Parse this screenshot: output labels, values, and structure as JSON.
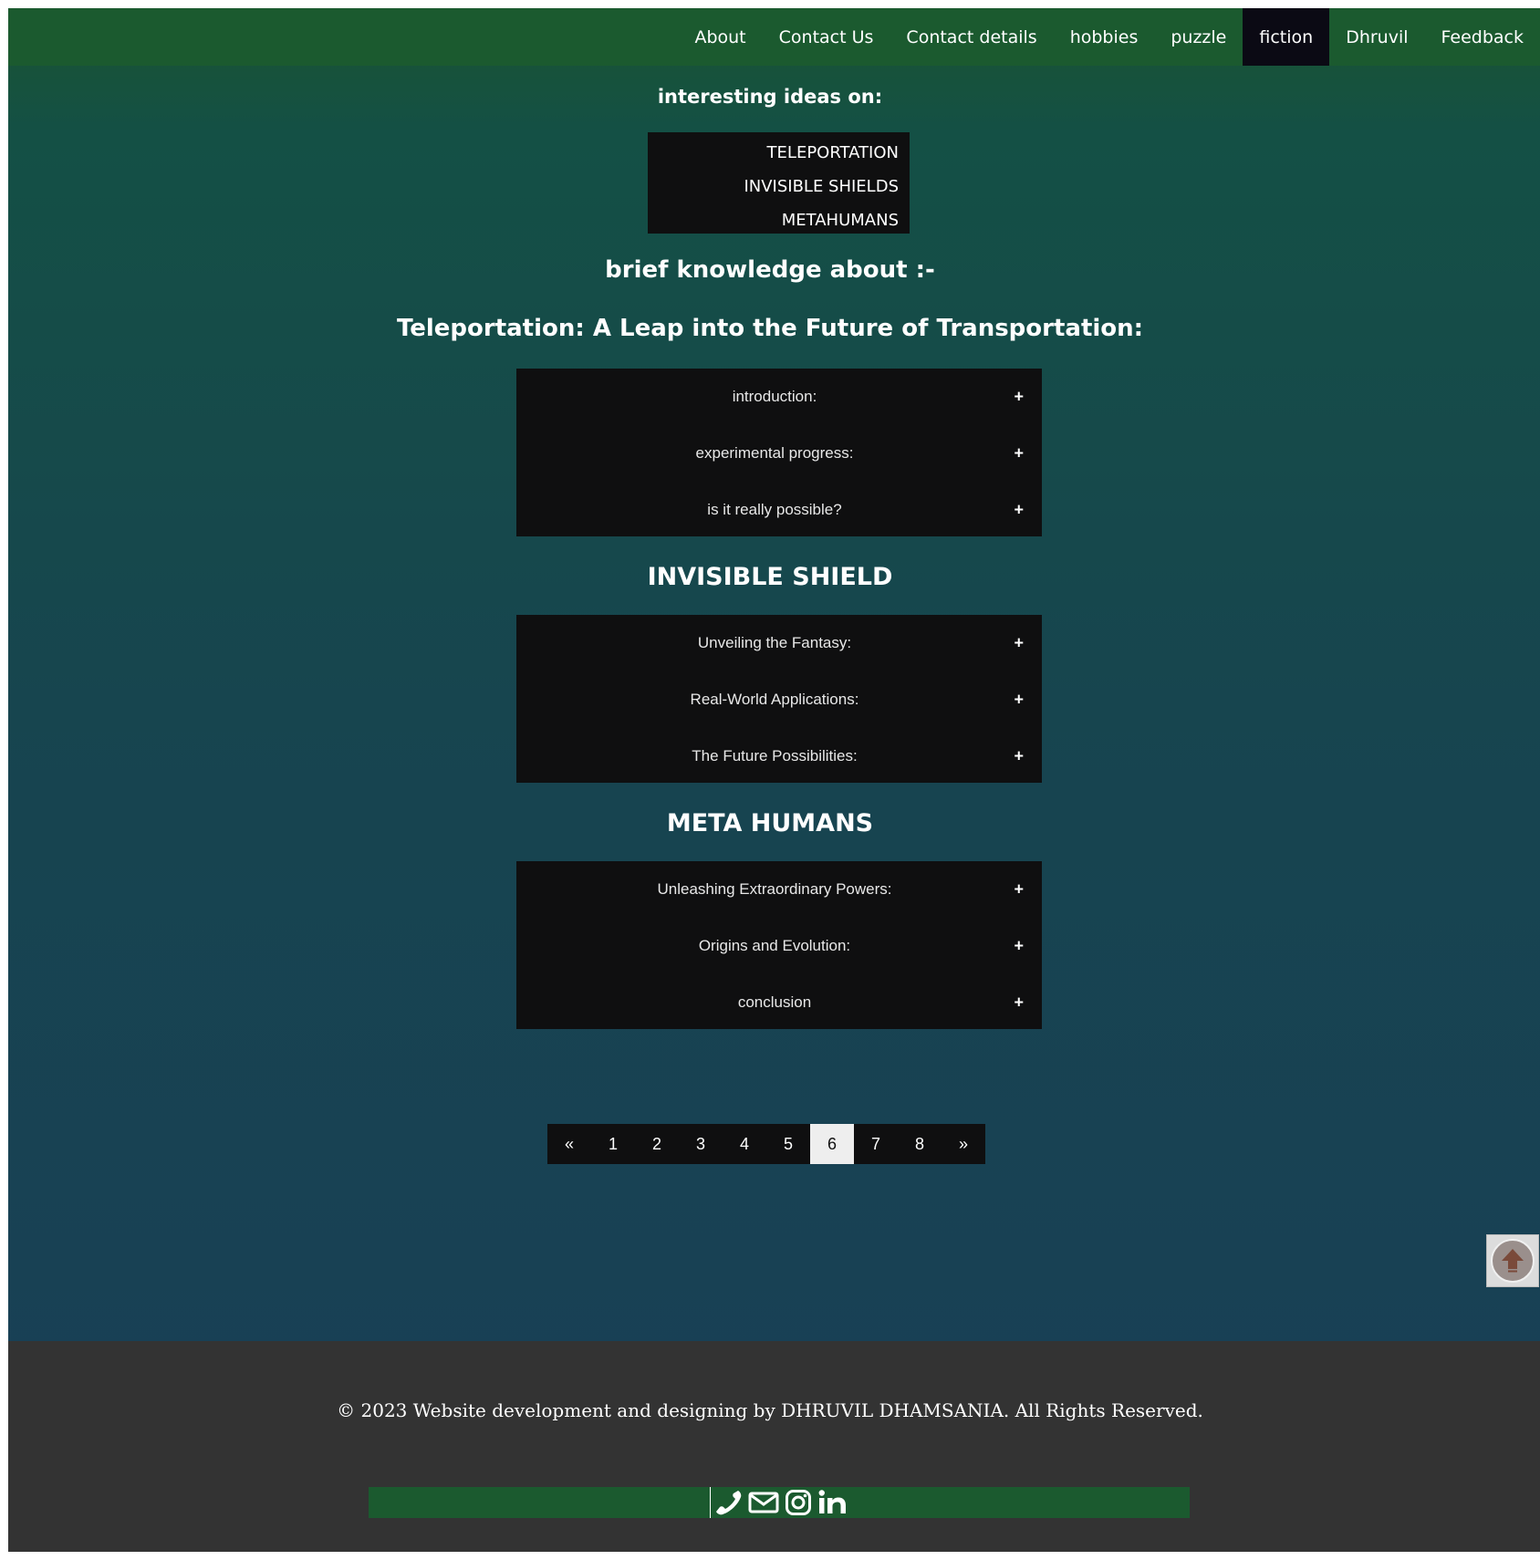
{
  "nav": {
    "items": [
      {
        "label": "About"
      },
      {
        "label": "Contact Us"
      },
      {
        "label": "Contact details"
      },
      {
        "label": "hobbies"
      },
      {
        "label": "puzzle"
      },
      {
        "label": "fiction"
      },
      {
        "label": "Dhruvil"
      },
      {
        "label": "Feedback"
      }
    ],
    "active": "fiction"
  },
  "ideas": {
    "heading": "interesting ideas on:",
    "items": [
      "TELEPORTATION",
      "INVISIBLE SHIELDS",
      "METAHUMANS"
    ]
  },
  "brief_heading": "brief knowledge about :-",
  "sections": [
    {
      "title": "Teleportation: A Leap into the Future of Transportation:",
      "items": [
        "introduction:",
        "experimental progress:",
        "is it really possible?"
      ]
    },
    {
      "title": "INVISIBLE SHIELD",
      "items": [
        "Unveiling the Fantasy:",
        "Real-World Applications:",
        "The Future Possibilities:"
      ]
    },
    {
      "title": "META HUMANS",
      "items": [
        "Unleashing Extraordinary Powers:",
        "Origins and Evolution:",
        "conclusion"
      ]
    }
  ],
  "accordion_icon": "+",
  "pagination": {
    "prev": "«",
    "pages": [
      "1",
      "2",
      "3",
      "4",
      "5",
      "6",
      "7",
      "8"
    ],
    "next": "»",
    "current": "6"
  },
  "back_to_top_icon": "up-arrow-icon",
  "footer": {
    "copyright": "© 2023 Website development and designing by DHRUVIL DHAMSANIA. All Rights Reserved.",
    "social_icons": [
      "phone-icon",
      "mail-icon",
      "instagram-icon",
      "linkedin-icon"
    ]
  },
  "colors": {
    "nav_bg": "#1b5a2f",
    "nav_active_bg": "#0b0a14",
    "panel_bg": "#0f0f10",
    "footer_bg": "#333333",
    "social_bar_bg": "#1b5a2f",
    "back_to_top_arrow": "#7a4a3a"
  }
}
